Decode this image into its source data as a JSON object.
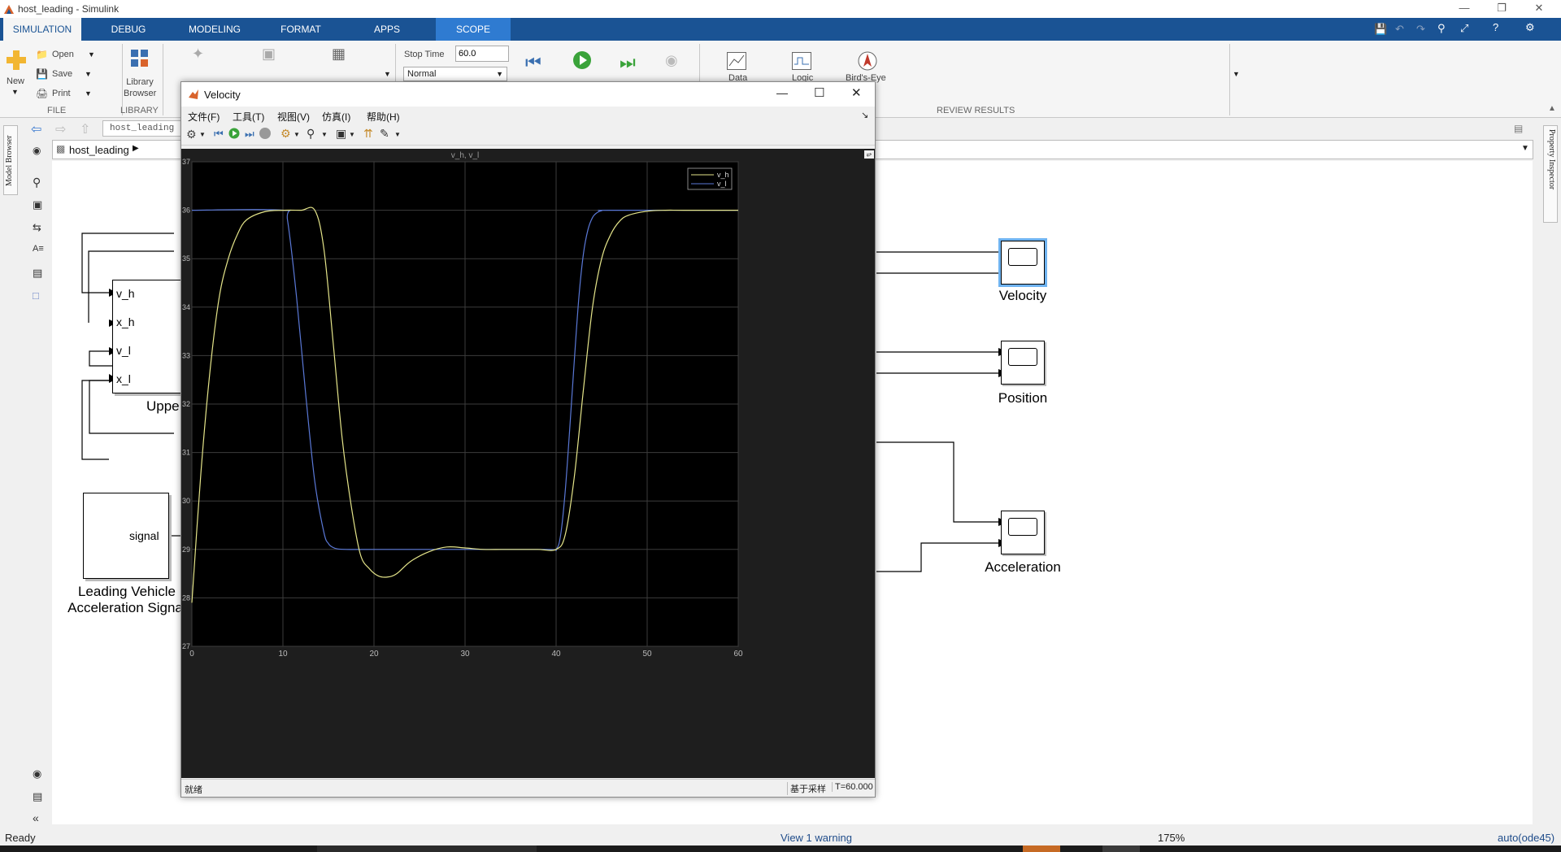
{
  "window": {
    "title": "host_leading - Simulink"
  },
  "tabs": [
    "SIMULATION",
    "DEBUG",
    "MODELING",
    "FORMAT",
    "APPS",
    "SCOPE"
  ],
  "ribbon": {
    "file": {
      "new": "New",
      "open": "Open",
      "save": "Save",
      "print": "Print",
      "section": "FILE"
    },
    "library": {
      "browser": "Library Browser",
      "section": "LIBRARY"
    },
    "stop_time_label": "Stop Time",
    "stop_time_value": "60.0",
    "sim_mode": "Normal",
    "review": {
      "data": "Data",
      "logic": "Logic",
      "birds_eye": "Bird's-Eye",
      "section": "REVIEW RESULTS"
    }
  },
  "editor": {
    "address": "host_leading",
    "breadcrumb": "host_leading",
    "model_browser": "Model Browser",
    "property_inspector": "Property Inspector"
  },
  "blocks": {
    "upper": {
      "ports": [
        "v_h",
        "x_h",
        "v_l",
        "x_l"
      ],
      "name": "Uppe"
    },
    "signal": {
      "label": "signal",
      "name1": "Leading Vehicle",
      "name2": "Acceleration Signa"
    },
    "scopes": [
      "Velocity",
      "Position",
      "Acceleration"
    ]
  },
  "scope": {
    "title": "Velocity",
    "menus": [
      "文件(F)",
      "工具(T)",
      "视图(V)",
      "仿真(I)",
      "帮助(H)"
    ],
    "status_left": "就绪",
    "status_mid": "基于采样",
    "status_right": "T=60.000"
  },
  "chart_data": {
    "type": "line",
    "title": "v_h, v_l",
    "xlim": [
      0,
      60
    ],
    "ylim": [
      27,
      37
    ],
    "xticks": [
      0,
      10,
      20,
      30,
      40,
      50,
      60
    ],
    "yticks": [
      27,
      28,
      29,
      30,
      31,
      32,
      33,
      34,
      35,
      36,
      37
    ],
    "grid": true,
    "legend_position": "top-right",
    "series": [
      {
        "name": "v_h",
        "color": "#e5e58a",
        "x": [
          0,
          1,
          2,
          3,
          4,
          5,
          6,
          8,
          10,
          12,
          13.5,
          14.5,
          15.5,
          16.5,
          17.5,
          18.5,
          19.5,
          20.5,
          21.5,
          22.5,
          24,
          26,
          28,
          30,
          32,
          34,
          36,
          38,
          40,
          41,
          42,
          43,
          44,
          45,
          46,
          47,
          48,
          50,
          52,
          54,
          60
        ],
        "values": [
          27.9,
          30.6,
          32.7,
          34.2,
          35.0,
          35.5,
          35.8,
          35.97,
          36,
          36,
          36,
          35.2,
          33.3,
          31.3,
          29.9,
          28.9,
          28.6,
          28.45,
          28.43,
          28.5,
          28.75,
          28.95,
          29.05,
          29.03,
          29.0,
          29.0,
          29.0,
          29.0,
          29.0,
          29.3,
          30.5,
          32.3,
          34.0,
          35.0,
          35.5,
          35.78,
          35.9,
          35.98,
          36.0,
          36.0,
          36.0
        ]
      },
      {
        "name": "v_l",
        "color": "#5a78d6",
        "x": [
          0,
          10,
          10.5,
          11.5,
          12.5,
          13.5,
          14.5,
          15,
          15.5,
          16,
          17,
          20,
          30,
          39,
          40,
          40.5,
          41,
          41.5,
          42,
          42.5,
          43,
          43.5,
          44,
          44.5,
          45,
          46,
          60
        ],
        "values": [
          36,
          36,
          35.8,
          34.2,
          32.2,
          30.4,
          29.35,
          29.12,
          29.04,
          29.01,
          29.0,
          29.0,
          29.0,
          29.0,
          29.0,
          29.3,
          30.2,
          31.5,
          32.9,
          34.2,
          35.1,
          35.6,
          35.85,
          35.95,
          35.99,
          36.0,
          36.0
        ]
      }
    ]
  }
}
